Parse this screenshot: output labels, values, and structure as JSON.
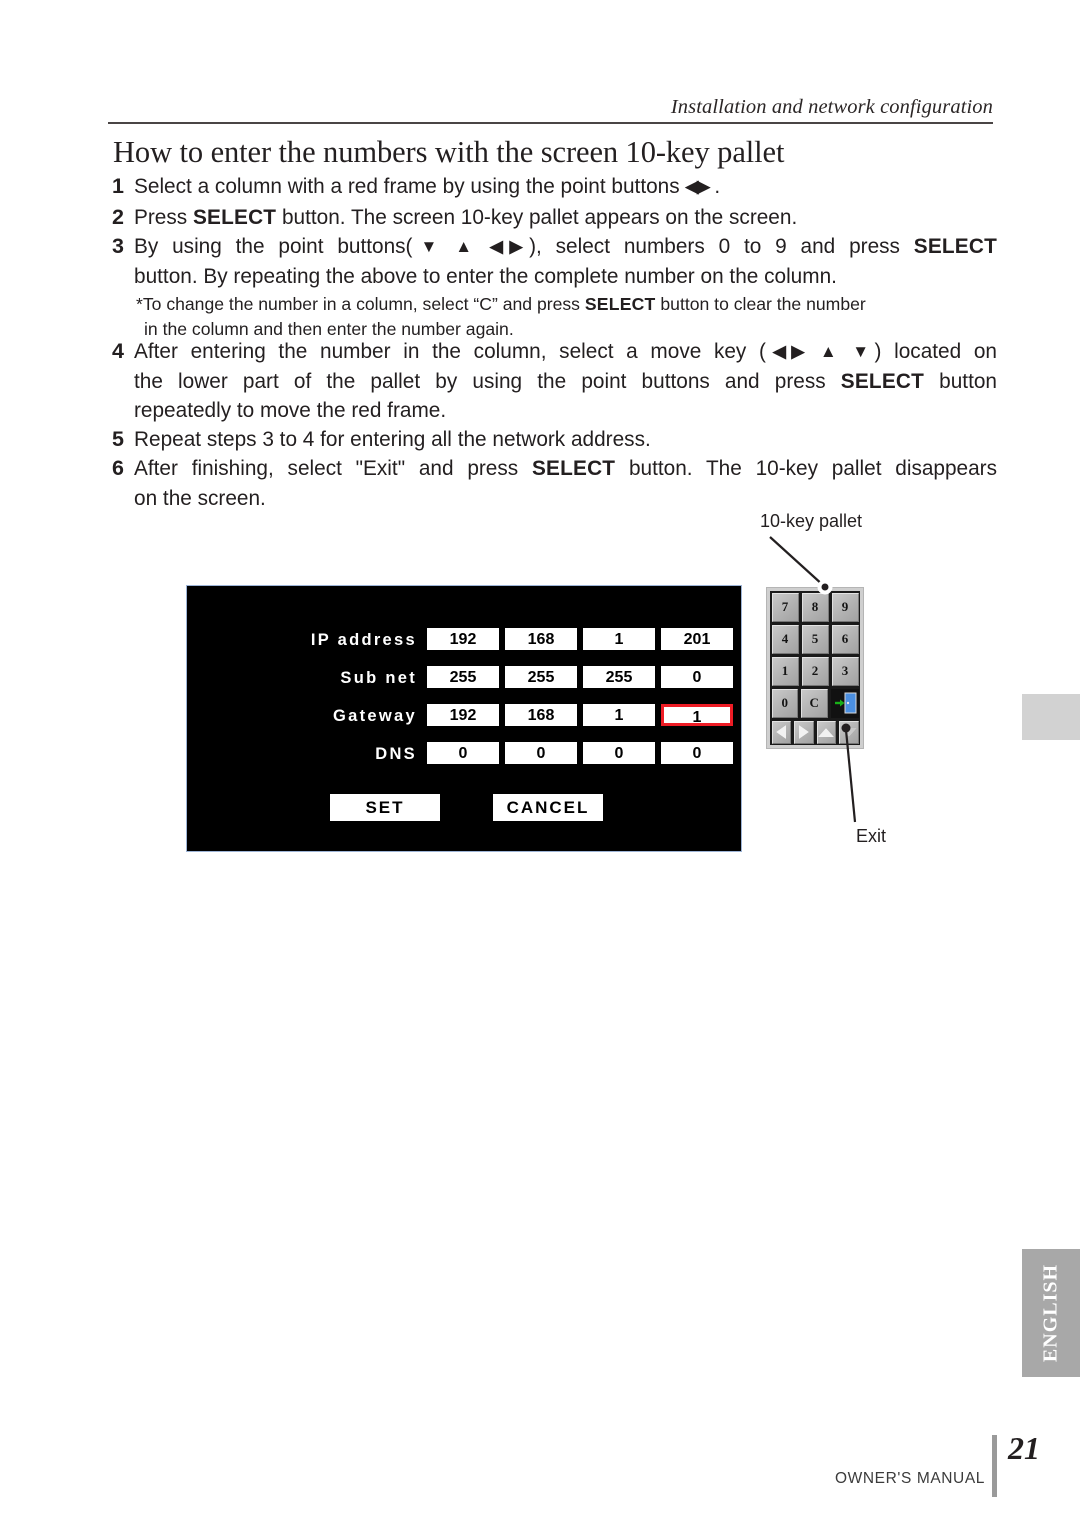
{
  "header": {
    "running_head": "Installation and network configuration"
  },
  "title": "How to enter the numbers with the screen 10-key pallet",
  "steps": [
    {
      "num": "1",
      "text_before": "Select a column with a red frame by using the point buttons ",
      "glyphs": "◀▶",
      "text_after": " ."
    },
    {
      "num": "2",
      "part1": "Press ",
      "bold": "SELECT",
      "part2": " button. The screen 10-key pallet appears on the screen."
    },
    {
      "num": "3",
      "line1_a": "By using the point buttons(",
      "line1_glyphs": "▼ ▲ ◀▶",
      "line1_b": "), select numbers 0 to 9 and press ",
      "line1_bold": "SELECT",
      "line2": "button. By repeating the above to enter the complete number on the column."
    },
    {
      "num": "4",
      "line1_a": "After entering the number in the column, select a move key (",
      "line1_glyphs": "◀▶ ▲ ▼",
      "line1_b": ") located on",
      "line2_a": "the lower part of the pallet by using the point buttons and press ",
      "line2_bold": "SELECT",
      "line2_b": " button",
      "line3": "repeatedly to move the red frame."
    },
    {
      "num": "5",
      "text": "Repeat steps 3 to 4 for entering all the network address."
    },
    {
      "num": "6",
      "line1_a": "After finishing, select \"Exit\" and press ",
      "line1_bold": "SELECT",
      "line1_b": " button. The 10-key pallet disappears",
      "line2": "on the screen."
    }
  ],
  "note": {
    "line1_a": "*To change the number in a column, select “C” and press ",
    "line1_bold": "SELECT",
    "line1_b": " button to clear the number",
    "line2": "in the column and then enter the number again."
  },
  "osd": {
    "rows": [
      {
        "label": "IP address",
        "values": [
          "192",
          "168",
          "1",
          "201"
        ],
        "focus_index": -1
      },
      {
        "label": "Sub net",
        "values": [
          "255",
          "255",
          "255",
          "0"
        ],
        "focus_index": -1
      },
      {
        "label": "Gateway",
        "values": [
          "192",
          "168",
          "1",
          "1"
        ],
        "focus_index": 3
      },
      {
        "label": "DNS",
        "values": [
          "0",
          "0",
          "0",
          "0"
        ],
        "focus_index": -1
      }
    ],
    "set_label": "SET",
    "cancel_label": "CANCEL",
    "focus_color": "#ee1c25",
    "background": "#000000"
  },
  "pallet": {
    "rows": [
      [
        "7",
        "8",
        "9"
      ],
      [
        "4",
        "5",
        "6"
      ],
      [
        "1",
        "2",
        "3"
      ],
      [
        "0",
        "C",
        "exit-icon"
      ]
    ],
    "arrow_row": [
      "left-arrow-icon",
      "right-arrow-icon",
      "up-arrow-icon",
      "down-arrow-icon"
    ]
  },
  "callouts": {
    "pallet": "10-key pallet",
    "exit": "Exit"
  },
  "sidebar": {
    "language": "ENGLISH"
  },
  "footer": {
    "manual": "OWNER'S MANUAL",
    "page": "21"
  }
}
